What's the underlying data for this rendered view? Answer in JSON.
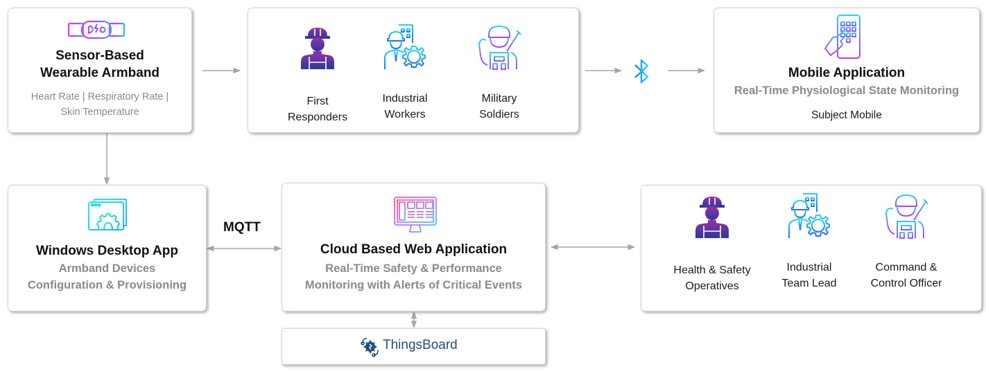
{
  "diagram": {
    "armband": {
      "icon": "wearable-armband-icon",
      "title_line1": "Sensor-Based",
      "title_line2": "Wearable Armband",
      "metrics_line1": "Heart Rate | Respiratory Rate |",
      "metrics_line2": "Skin Temperature"
    },
    "subjects": {
      "items": [
        {
          "icon": "first-responder-icon",
          "line1": "First",
          "line2": "Responders"
        },
        {
          "icon": "industrial-worker-icon",
          "line1": "Industrial",
          "line2": "Workers"
        },
        {
          "icon": "military-soldier-icon",
          "line1": "Military",
          "line2": "Soldiers"
        }
      ]
    },
    "link_subjects_mobile": {
      "icon": "bluetooth-icon"
    },
    "mobile": {
      "icon": "mobile-app-icon",
      "title": "Mobile Application",
      "subtitle": "Real-Time Physiological State Monitoring",
      "device": "Subject Mobile"
    },
    "desktop": {
      "icon": "desktop-config-icon",
      "title": "Windows Desktop App",
      "subtitle_line1": "Armband Devices",
      "subtitle_line2": "Configuration & Provisioning"
    },
    "protocol_label": "MQTT",
    "cloud": {
      "icon": "web-dashboard-icon",
      "title": "Cloud Based Web Application",
      "subtitle_line1": "Real-Time Safety & Performance",
      "subtitle_line2": "Monitoring with Alerts of Critical Events"
    },
    "supervisors": {
      "items": [
        {
          "icon": "safety-operative-icon",
          "line1": "Health & Safety",
          "line2": "Operatives"
        },
        {
          "icon": "team-lead-icon",
          "line1": "Industrial",
          "line2": "Team Lead"
        },
        {
          "icon": "command-officer-icon",
          "line1": "Command &",
          "line2": "Control Officer"
        }
      ]
    },
    "platform": {
      "icon": "thingsboard-logo-icon",
      "name": "ThingsBoard"
    },
    "colors": {
      "arrow": "#a6a6a6",
      "subtitle": "#8a8a8a",
      "thingsboard": "#1f4e79",
      "gradient_pink": "#ff3cac",
      "gradient_purple": "#9b4dff",
      "gradient_blue": "#1e90ff",
      "gradient_cyan": "#22d3ee",
      "bluetooth": "#1fb6f5"
    }
  }
}
